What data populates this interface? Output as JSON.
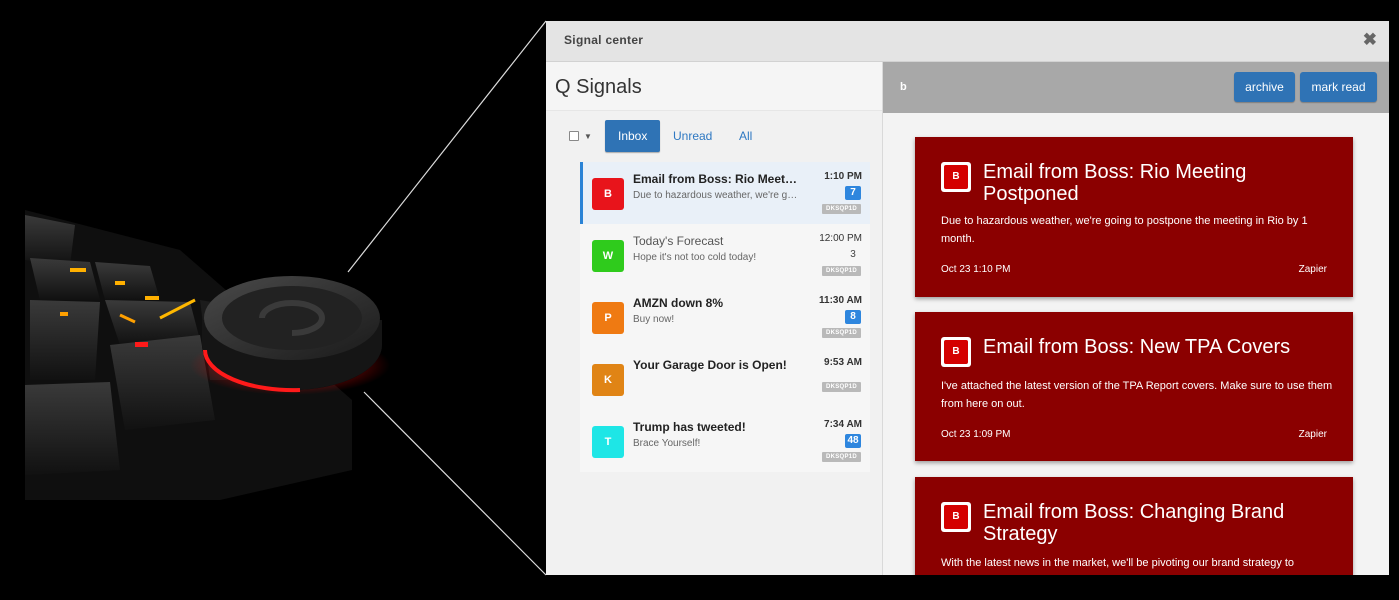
{
  "window": {
    "title": "Signal center",
    "close_glyph": "✖"
  },
  "left": {
    "heading": "Q Signals",
    "tabs": [
      {
        "label": "Inbox",
        "active": true
      },
      {
        "label": "Unread"
      },
      {
        "label": "All"
      }
    ],
    "items": [
      {
        "initial": "B",
        "color": "#e8141b",
        "title": "Email from Boss: Rio Meeting Postponed",
        "subtitle": "Due to hazardous weather, we're going to postpone the meeting",
        "time": "1:10 PM",
        "count": "7",
        "tag": "DKSQP1D"
      },
      {
        "initial": "W",
        "color": "#2fcb1c",
        "title": "Today's Forecast",
        "subtitle": "Hope it's not too cold today!",
        "time": "12:00 PM",
        "count": "3",
        "tag": "DKSQP1D"
      },
      {
        "initial": "P",
        "color": "#ef7a12",
        "title": "AMZN down 8%",
        "subtitle": "Buy now!",
        "time": "11:30 AM",
        "count": "8",
        "tag": "DKSQP1D"
      },
      {
        "initial": "K",
        "color": "#e08415",
        "title": "Your Garage Door is Open!",
        "subtitle": "",
        "time": "9:53 AM",
        "count": "",
        "tag": "DKSQP1D"
      },
      {
        "initial": "T",
        "color": "#1ee6e6",
        "title": "Trump has tweeted!",
        "subtitle": "Brace Yourself!",
        "time": "7:34 AM",
        "count": "48",
        "tag": "DKSQP1D"
      }
    ]
  },
  "right": {
    "header_label": "b",
    "archive_label": "archive",
    "mark_read_label": "mark read",
    "cards": [
      {
        "initial": "B",
        "title": "Email from Boss: Rio Meeting Postponed",
        "body": "Due to hazardous weather, we're going to postpone the meeting in Rio by 1 month.",
        "date": "Oct 23 1:10 PM",
        "source": "Zapier"
      },
      {
        "initial": "B",
        "title": "Email from Boss: New TPA Covers",
        "body": "I've attached the latest version of the TPA Report covers. Make sure to use them from here on out.",
        "date": "Oct 23 1:09 PM",
        "source": "Zapier"
      },
      {
        "initial": "B",
        "title": "Email from Boss: Changing Brand Strategy",
        "body": "With the latest news in the market, we'll be pivoting our brand strategy to",
        "date": "",
        "source": ""
      }
    ]
  },
  "colors": {
    "accent": "#2f73b5",
    "card_bg": "#8b0000",
    "selected_bar": "#2a83d6",
    "glow": "#ff1a1a"
  }
}
